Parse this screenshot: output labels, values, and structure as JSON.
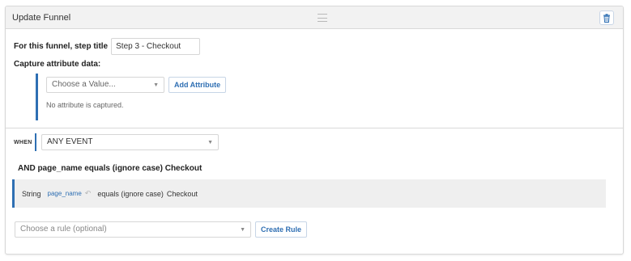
{
  "header": {
    "title": "Update Funnel",
    "drag_icon": "drag-handle-icon",
    "delete_icon": "trash-icon"
  },
  "step_title": {
    "label": "For this funnel, step title",
    "value": "Step 3 - Checkout"
  },
  "capture": {
    "label": "Capture attribute data:",
    "select_placeholder": "Choose a Value...",
    "add_button": "Add Attribute",
    "empty_text": "No attribute is captured."
  },
  "event": {
    "when_label": "WHEN",
    "selected": "ANY EVENT"
  },
  "condition_summary": "AND page_name equals (ignore case) Checkout",
  "condition": {
    "type": "String",
    "field": "page_name",
    "operator": "equals (ignore case)",
    "value": "Checkout"
  },
  "rule": {
    "placeholder": "Choose a rule (optional)",
    "create_button": "Create Rule"
  },
  "colors": {
    "accent": "#2e6fb3",
    "header_bg": "#f2f2f2",
    "condition_bg": "#efefef"
  }
}
